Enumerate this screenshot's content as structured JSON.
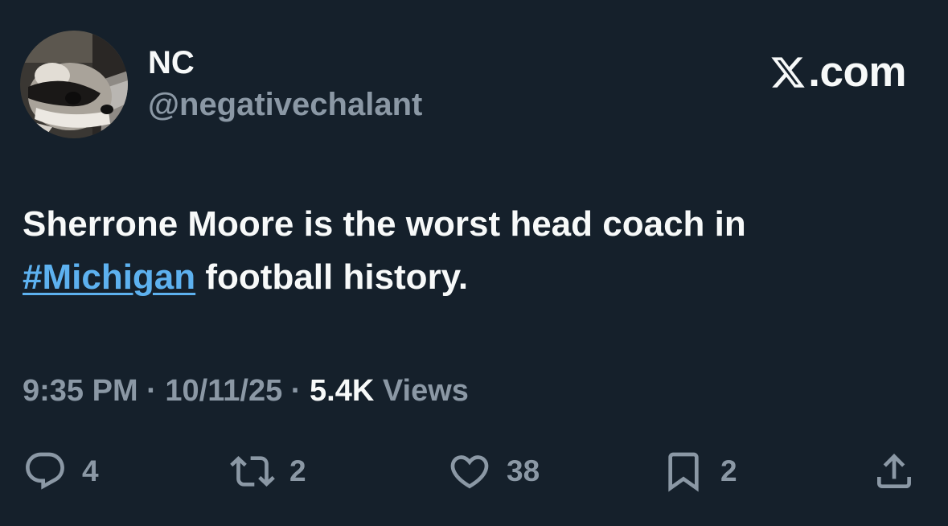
{
  "author": {
    "display_name": "NC",
    "handle": "@negativechalant",
    "avatar": "raccoon-avatar"
  },
  "brand": {
    "icon": "x-logo-icon",
    "label": ".com"
  },
  "tweet": {
    "text_before": "Sherrone Moore is the worst head coach in ",
    "hashtag": "#Michigan",
    "text_after": " football history."
  },
  "meta": {
    "time": "9:35 PM",
    "separator": " · ",
    "date": "10/11/25",
    "views_count": "5.4K",
    "views_label": " Views"
  },
  "actions": [
    {
      "name": "reply",
      "icon": "reply-icon",
      "count": "4"
    },
    {
      "name": "retweet",
      "icon": "retweet-icon",
      "count": "2"
    },
    {
      "name": "like",
      "icon": "heart-icon",
      "count": "38"
    },
    {
      "name": "bookmark",
      "icon": "bookmark-icon",
      "count": "2"
    },
    {
      "name": "share",
      "icon": "share-icon",
      "count": ""
    }
  ],
  "colors": {
    "background": "#15202b",
    "text_primary": "#f7f9f9",
    "text_secondary": "#8b98a5",
    "link": "#5db1ef"
  }
}
